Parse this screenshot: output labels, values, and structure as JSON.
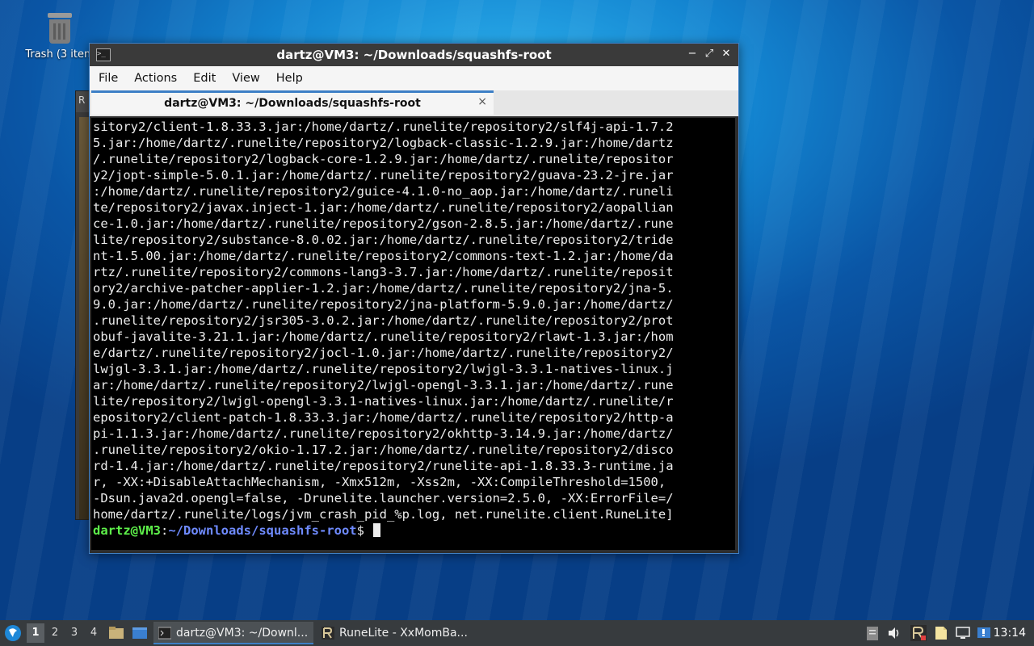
{
  "desktop": {
    "trash_label": "Trash (3 item"
  },
  "background_window": {
    "title_initial": "R"
  },
  "window": {
    "title": "dartz@VM3: ~/Downloads/squashfs-root",
    "menu": [
      "File",
      "Actions",
      "Edit",
      "View",
      "Help"
    ],
    "tab_label": "dartz@VM3: ~/Downloads/squashfs-root",
    "tab_close": "×",
    "controls": {
      "minimize": "−",
      "maximize": "⤢",
      "close": "✕"
    }
  },
  "terminal": {
    "lines": [
      "sitory2/client-1.8.33.3.jar:/home/dartz/.runelite/repository2/slf4j-api-1.7.2",
      "5.jar:/home/dartz/.runelite/repository2/logback-classic-1.2.9.jar:/home/dartz",
      "/.runelite/repository2/logback-core-1.2.9.jar:/home/dartz/.runelite/repositor",
      "y2/jopt-simple-5.0.1.jar:/home/dartz/.runelite/repository2/guava-23.2-jre.jar",
      ":/home/dartz/.runelite/repository2/guice-4.1.0-no_aop.jar:/home/dartz/.runeli",
      "te/repository2/javax.inject-1.jar:/home/dartz/.runelite/repository2/aopallian",
      "ce-1.0.jar:/home/dartz/.runelite/repository2/gson-2.8.5.jar:/home/dartz/.rune",
      "lite/repository2/substance-8.0.02.jar:/home/dartz/.runelite/repository2/tride",
      "nt-1.5.00.jar:/home/dartz/.runelite/repository2/commons-text-1.2.jar:/home/da",
      "rtz/.runelite/repository2/commons-lang3-3.7.jar:/home/dartz/.runelite/reposit",
      "ory2/archive-patcher-applier-1.2.jar:/home/dartz/.runelite/repository2/jna-5.",
      "9.0.jar:/home/dartz/.runelite/repository2/jna-platform-5.9.0.jar:/home/dartz/",
      ".runelite/repository2/jsr305-3.0.2.jar:/home/dartz/.runelite/repository2/prot",
      "obuf-javalite-3.21.1.jar:/home/dartz/.runelite/repository2/rlawt-1.3.jar:/hom",
      "e/dartz/.runelite/repository2/jocl-1.0.jar:/home/dartz/.runelite/repository2/",
      "lwjgl-3.3.1.jar:/home/dartz/.runelite/repository2/lwjgl-3.3.1-natives-linux.j",
      "ar:/home/dartz/.runelite/repository2/lwjgl-opengl-3.3.1.jar:/home/dartz/.rune",
      "lite/repository2/lwjgl-opengl-3.3.1-natives-linux.jar:/home/dartz/.runelite/r",
      "epository2/client-patch-1.8.33.3.jar:/home/dartz/.runelite/repository2/http-a",
      "pi-1.1.3.jar:/home/dartz/.runelite/repository2/okhttp-3.14.9.jar:/home/dartz/",
      ".runelite/repository2/okio-1.17.2.jar:/home/dartz/.runelite/repository2/disco",
      "rd-1.4.jar:/home/dartz/.runelite/repository2/runelite-api-1.8.33.3-runtime.ja",
      "r, -XX:+DisableAttachMechanism, -Xmx512m, -Xss2m, -XX:CompileThreshold=1500, ",
      "-Dsun.java2d.opengl=false, -Drunelite.launcher.version=2.5.0, -XX:ErrorFile=/",
      "home/dartz/.runelite/logs/jvm_crash_pid_%p.log, net.runelite.client.RuneLite]"
    ],
    "prompt_user": "dartz@VM3",
    "prompt_sep": ":",
    "prompt_path": "~/Downloads/squashfs-root",
    "prompt_symbol": "$ "
  },
  "taskbar": {
    "workspaces": [
      "1",
      "2",
      "3",
      "4"
    ],
    "active_workspace": "1",
    "tasks": [
      {
        "label": "dartz@VM3: ~/Downl...",
        "icon": "terminal-icon",
        "active": true
      },
      {
        "label": "RuneLite - XxMomBa...",
        "icon": "runelite-icon",
        "active": false
      }
    ],
    "clock": "13:14"
  },
  "colors": {
    "accent": "#3d7fc6",
    "prompt_user": "#5ef14a",
    "prompt_path": "#6f8bff",
    "taskbar": "#373b3e"
  }
}
